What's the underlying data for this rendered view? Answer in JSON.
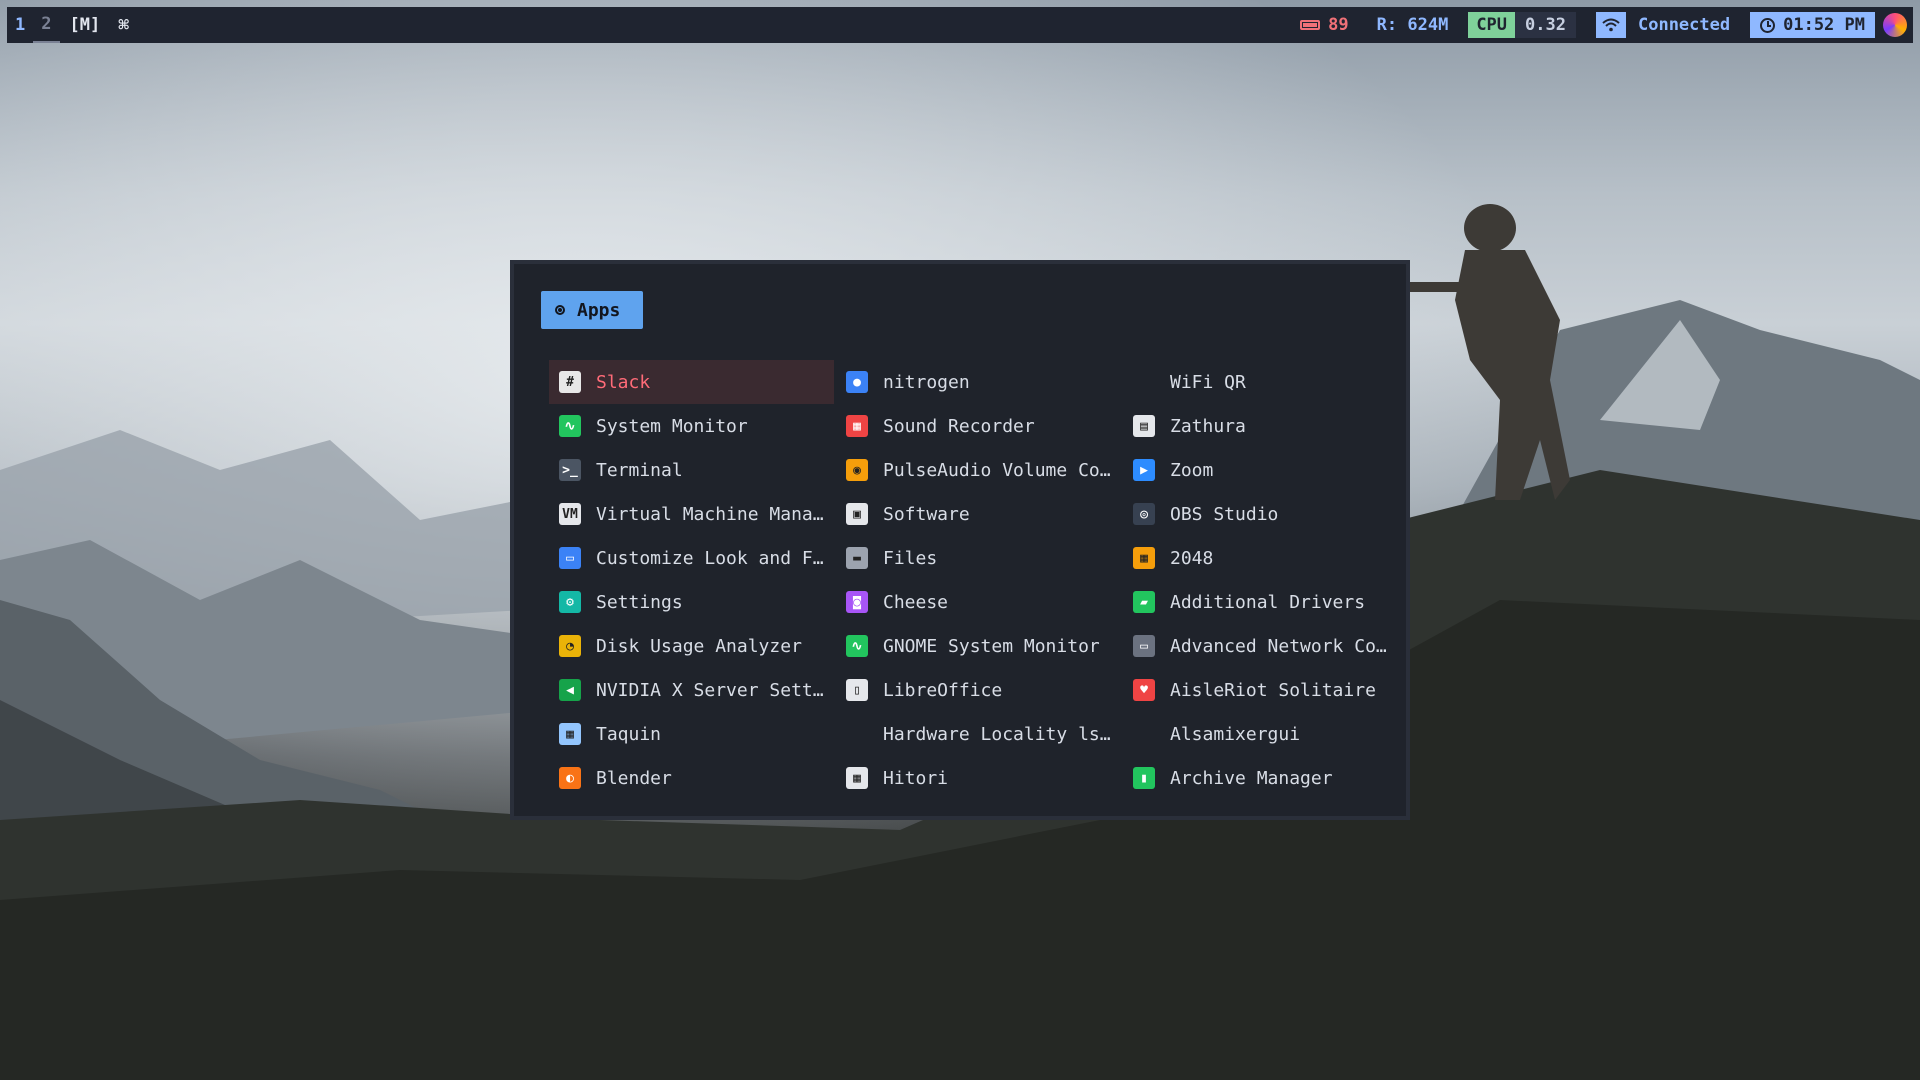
{
  "topbar": {
    "workspaces": [
      "1",
      "2"
    ],
    "mode": "[M]",
    "command_glyph": "⌘",
    "battery": "89",
    "ram": "R: 624M",
    "cpu_label": "CPU",
    "cpu_value": "0.32",
    "wifi_status": "Connected",
    "time": "01:52 PM"
  },
  "launcher": {
    "mode_label": "Apps",
    "entries": [
      {
        "label": "Slack",
        "icon": "slack-icon",
        "color": "#e8e8e8"
      },
      {
        "label": "nitrogen",
        "icon": "nitrogen-icon",
        "color": "#3b82f6"
      },
      {
        "label": "WiFi QR",
        "icon": "",
        "color": ""
      },
      {
        "label": "System Monitor",
        "icon": "system-monitor-icon",
        "color": "#22c55e"
      },
      {
        "label": "Sound Recorder",
        "icon": "sound-recorder-icon",
        "color": "#ef4444"
      },
      {
        "label": "Zathura",
        "icon": "zathura-icon",
        "color": "#e5e7eb"
      },
      {
        "label": "Terminal",
        "icon": "terminal-icon",
        "color": "#4b5563"
      },
      {
        "label": "PulseAudio Volume Con…",
        "icon": "pulseaudio-icon",
        "color": "#f59e0b"
      },
      {
        "label": "Zoom",
        "icon": "zoom-icon",
        "color": "#2d8cff"
      },
      {
        "label": "Virtual Machine Manag…",
        "icon": "virt-manager-icon",
        "color": "#e5e7eb"
      },
      {
        "label": "Software",
        "icon": "software-icon",
        "color": "#e5e7eb"
      },
      {
        "label": "OBS Studio",
        "icon": "obs-icon",
        "color": "#374151"
      },
      {
        "label": "Customize Look and Fe…",
        "icon": "customize-icon",
        "color": "#3b82f6"
      },
      {
        "label": "Files",
        "icon": "files-icon",
        "color": "#9ca3af"
      },
      {
        "label": "2048",
        "icon": "game-2048-icon",
        "color": "#f59e0b"
      },
      {
        "label": "Settings",
        "icon": "settings-icon",
        "color": "#14b8a6"
      },
      {
        "label": "Cheese",
        "icon": "cheese-icon",
        "color": "#a855f7"
      },
      {
        "label": "Additional Drivers",
        "icon": "drivers-icon",
        "color": "#22c55e"
      },
      {
        "label": "Disk Usage Analyzer",
        "icon": "disk-usage-icon",
        "color": "#eab308"
      },
      {
        "label": "GNOME System Monitor",
        "icon": "gnome-system-monitor-icon",
        "color": "#22c55e"
      },
      {
        "label": "Advanced Network Conf…",
        "icon": "network-config-icon",
        "color": "#6b7280"
      },
      {
        "label": "NVIDIA X Server Setti…",
        "icon": "nvidia-icon",
        "color": "#16a34a"
      },
      {
        "label": "LibreOffice",
        "icon": "libreoffice-icon",
        "color": "#e5e7eb"
      },
      {
        "label": "AisleRiot Solitaire",
        "icon": "solitaire-icon",
        "color": "#ef4444"
      },
      {
        "label": "Taquin",
        "icon": "taquin-icon",
        "color": "#93c5fd"
      },
      {
        "label": "Hardware Locality lst…",
        "icon": "",
        "color": ""
      },
      {
        "label": "Alsamixergui",
        "icon": "",
        "color": ""
      },
      {
        "label": "Blender",
        "icon": "blender-icon",
        "color": "#f97316"
      },
      {
        "label": "Hitori",
        "icon": "hitori-icon",
        "color": "#e5e7eb"
      },
      {
        "label": "Archive Manager",
        "icon": "archive-manager-icon",
        "color": "#22c55e"
      }
    ]
  }
}
